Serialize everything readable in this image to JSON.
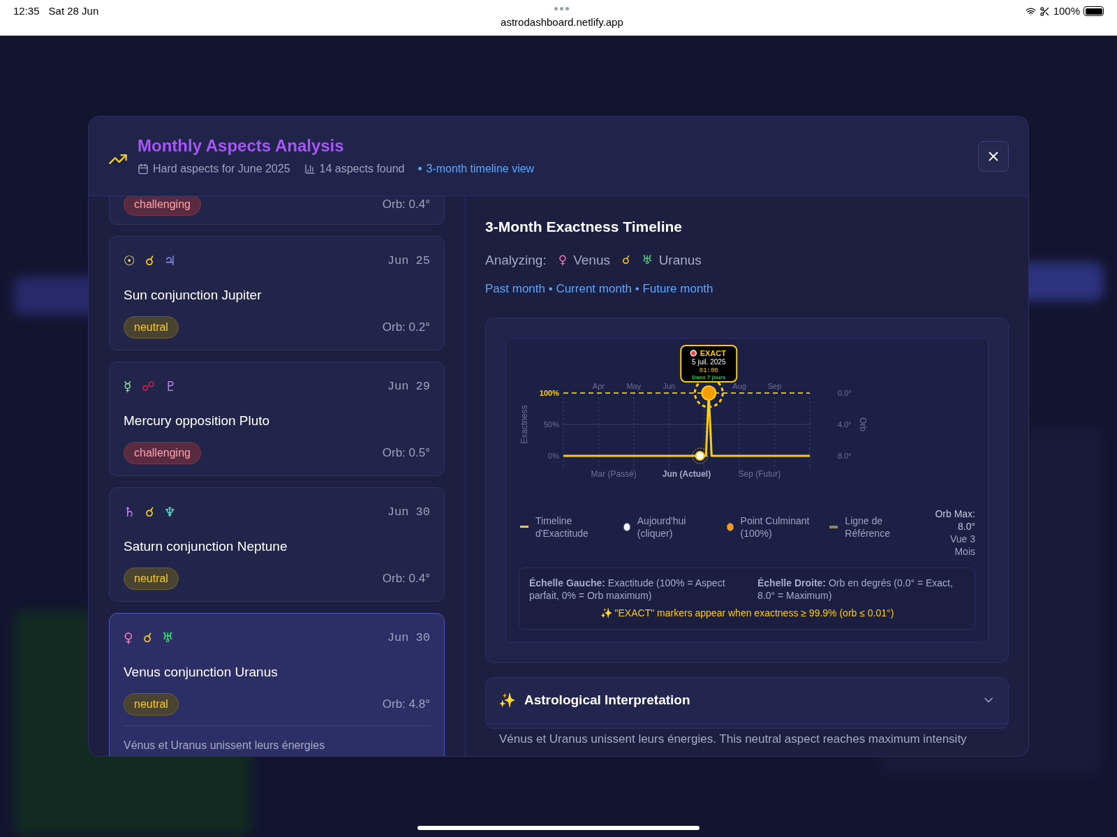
{
  "status_bar": {
    "time": "12:35",
    "date": "Sat 28 Jun",
    "url": "astrodashboard.netlify.app",
    "battery": "100%"
  },
  "modal": {
    "title": "Monthly Aspects Analysis",
    "meta": [
      {
        "kind": "calendar",
        "text": "Hard aspects for June 2025"
      },
      {
        "kind": "chart",
        "text": "14 aspects found"
      },
      {
        "kind": "dot",
        "text": "3-month timeline view"
      }
    ]
  },
  "aspects": [
    {
      "partial": true,
      "selected": false,
      "kind": "challenging",
      "tag": "challenging",
      "orb": "Orb: 0.4°"
    },
    {
      "partial": false,
      "selected": false,
      "kind": "neutral",
      "symbols": [
        {
          "char": "☉",
          "color": "#fde68a"
        },
        {
          "char": "☌",
          "color": "#facc15"
        },
        {
          "char": "♃",
          "color": "#818cf8"
        }
      ],
      "date": "Jun 25",
      "title": "Sun conjunction Jupiter",
      "tag": "neutral",
      "orb": "Orb: 0.2°"
    },
    {
      "partial": false,
      "selected": false,
      "kind": "challenging",
      "symbols": [
        {
          "char": "☿",
          "color": "#86efac"
        },
        {
          "char": "☍",
          "color": "#e11d48"
        },
        {
          "char": "♇",
          "color": "#c084fc"
        }
      ],
      "date": "Jun 29",
      "title": "Mercury opposition Pluto",
      "tag": "challenging",
      "orb": "Orb: 0.5°"
    },
    {
      "partial": false,
      "selected": false,
      "kind": "neutral",
      "symbols": [
        {
          "char": "♄",
          "color": "#c084fc"
        },
        {
          "char": "☌",
          "color": "#facc15"
        },
        {
          "char": "♆",
          "color": "#5eead4"
        }
      ],
      "date": "Jun 30",
      "title": "Saturn conjunction Neptune",
      "tag": "neutral",
      "orb": "Orb: 0.4°"
    },
    {
      "partial": false,
      "selected": true,
      "kind": "neutral",
      "symbols": [
        {
          "char": "♀",
          "color": "#f472b6"
        },
        {
          "char": "☌",
          "color": "#facc15"
        },
        {
          "char": "♅",
          "color": "#4ade80"
        }
      ],
      "date": "Jun 30",
      "title": "Venus conjunction Uranus",
      "tag": "neutral",
      "orb": "Orb: 4.8°",
      "description": "Vénus et Uranus unissent leurs énergies"
    }
  ],
  "timeline": {
    "heading": "3-Month Exactness Timeline",
    "analyzing_label": "Analyzing:",
    "analyzing": [
      {
        "char": "♀",
        "color": "#f472b6",
        "name": "Venus"
      },
      {
        "char": "☌",
        "color": "#facc15"
      },
      {
        "char": "♅",
        "color": "#4ade80",
        "name": "Uranus"
      }
    ],
    "subtitle": "Past month • Current month • Future month",
    "month_labels_before_peak": [
      "Apr",
      "May",
      "Jun"
    ],
    "month_labels_after_peak": [
      "Aug",
      "Sep"
    ],
    "axis_title": "Exactness",
    "axis2_title": "Orb",
    "exactness_labels": [
      "100%",
      "50%",
      "0%"
    ],
    "orb_labels": [
      "0.0°",
      "4.0°",
      "8.0°"
    ],
    "series_name": "Timeline d'Exactitude",
    "peak_title": "EXACT",
    "period_labels": [
      {
        "label": "Mar (Passé)",
        "current": false
      },
      {
        "label": "Jun (Actuel)",
        "current": true
      },
      {
        "label": "Sep (Futur)",
        "current": false
      }
    ],
    "peak_tooltip": {
      "date": "5 juil. 2025",
      "time": "01:00",
      "note": "Dans 7 jours"
    },
    "legend": [
      {
        "kind": "line",
        "color": "#facc15"
      },
      {
        "kind": "dot",
        "color": "#f1f5f9",
        "text": "Aujourd'hui (cliquer)"
      },
      {
        "kind": "dot",
        "color": "#f59e0b",
        "text": "Point Culminant (100%)"
      },
      {
        "kind": "ref",
        "color": "#8b8760",
        "text": "Ligne de Référence"
      }
    ],
    "orb_max": "Orb Max: 8.0°",
    "view": "Vue 3 Mois",
    "scales": [
      "**Échelle Gauche:** Exactitude (100% = Aspect parfait, 0% = Orb maximum)",
      "**Échelle Droite:** Orb en degrés (0.0° = Exact, 8.0° = Maximum)"
    ],
    "note": "✨ \"EXACT\" markers appear when exactness ≥ 99.9% (orb ≤ 0.01°)"
  },
  "interpretation": {
    "icon": "✨",
    "title": "Astrological Interpretation",
    "expanded": true,
    "text": "Vénus et Uranus unissent leurs énergies. This neutral aspect reaches maximum intensity"
  }
}
